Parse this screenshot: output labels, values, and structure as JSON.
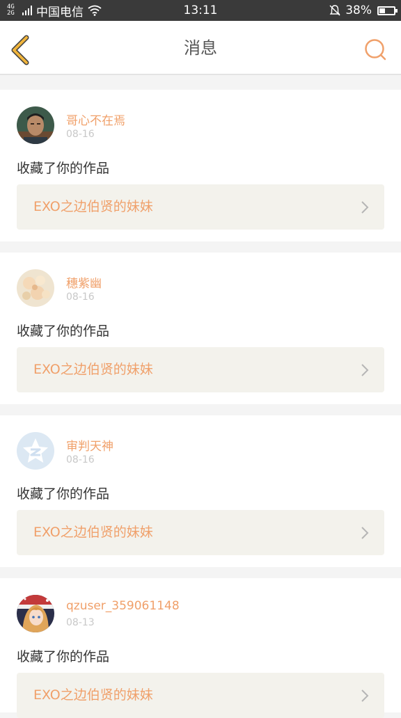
{
  "status_bar": {
    "network": "4G",
    "network_sub": "2G",
    "carrier": "中国电信",
    "time": "13:11",
    "battery_percent_text": "38%",
    "battery_level": 0.38
  },
  "header": {
    "title": "消息"
  },
  "messages": [
    {
      "user": "哥心不在焉",
      "date": "08-16",
      "action": "收藏了你的作品",
      "work_title": "EXO之边伯贤的妹妹"
    },
    {
      "user": "穗紫幽",
      "date": "08-16",
      "action": "收藏了你的作品",
      "work_title": "EXO之边伯贤的妹妹"
    },
    {
      "user": "审判天神",
      "date": "08-16",
      "action": "收藏了你的作品",
      "work_title": "EXO之边伯贤的妹妹"
    },
    {
      "user": "qzuser_359061148",
      "date": "08-13",
      "action": "收藏了你的作品",
      "work_title": "EXO之边伯贤的妹妹"
    }
  ],
  "colors": {
    "accent": "#f0a06a",
    "back_arrow": "#f0b43c",
    "status_bar_bg": "#3a3a3a",
    "page_bg": "#f4f4f4",
    "link_bg": "#f3f2ec"
  }
}
